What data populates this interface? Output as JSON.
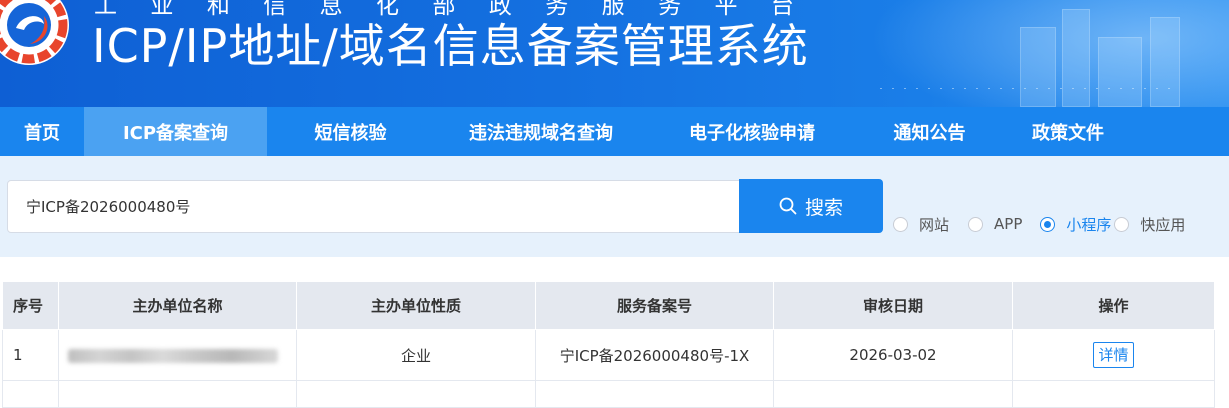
{
  "header": {
    "subtitle_chars": [
      "工",
      "业",
      "和",
      "信",
      "息",
      "化",
      "部",
      "政",
      "务",
      "服",
      "务",
      "平",
      "台"
    ],
    "title": "ICP/IP地址/域名信息备案管理系统"
  },
  "nav": {
    "items": [
      {
        "label": "首页",
        "active": false
      },
      {
        "label": "ICP备案查询",
        "active": true
      },
      {
        "label": "短信核验",
        "active": false
      },
      {
        "label": "违法违规域名查询",
        "active": false
      },
      {
        "label": "电子化核验申请",
        "active": false
      },
      {
        "label": "通知公告",
        "active": false
      },
      {
        "label": "政策文件",
        "active": false
      }
    ]
  },
  "search": {
    "value": "宁ICP备2026000480号",
    "button_label": "搜索",
    "icon": "search-icon",
    "options": [
      {
        "label": "网站",
        "checked": false
      },
      {
        "label": "APP",
        "checked": false
      },
      {
        "label": "小程序",
        "checked": true
      },
      {
        "label": "快应用",
        "checked": false
      }
    ]
  },
  "table": {
    "headers": [
      "序号",
      "主办单位名称",
      "主办单位性质",
      "服务备案号",
      "审核日期",
      "操作"
    ],
    "rows": [
      {
        "index": "1",
        "org_name": "",
        "org_type": "企业",
        "record_no": "宁ICP备2026000480号-1X",
        "date": "2026-03-02",
        "action": "详情"
      }
    ]
  },
  "colors": {
    "brand_blue": "#1a85ee",
    "nav_active": "#4ba2f2",
    "search_bg": "#e6f1fc",
    "table_header_bg": "#e4e8ef"
  }
}
